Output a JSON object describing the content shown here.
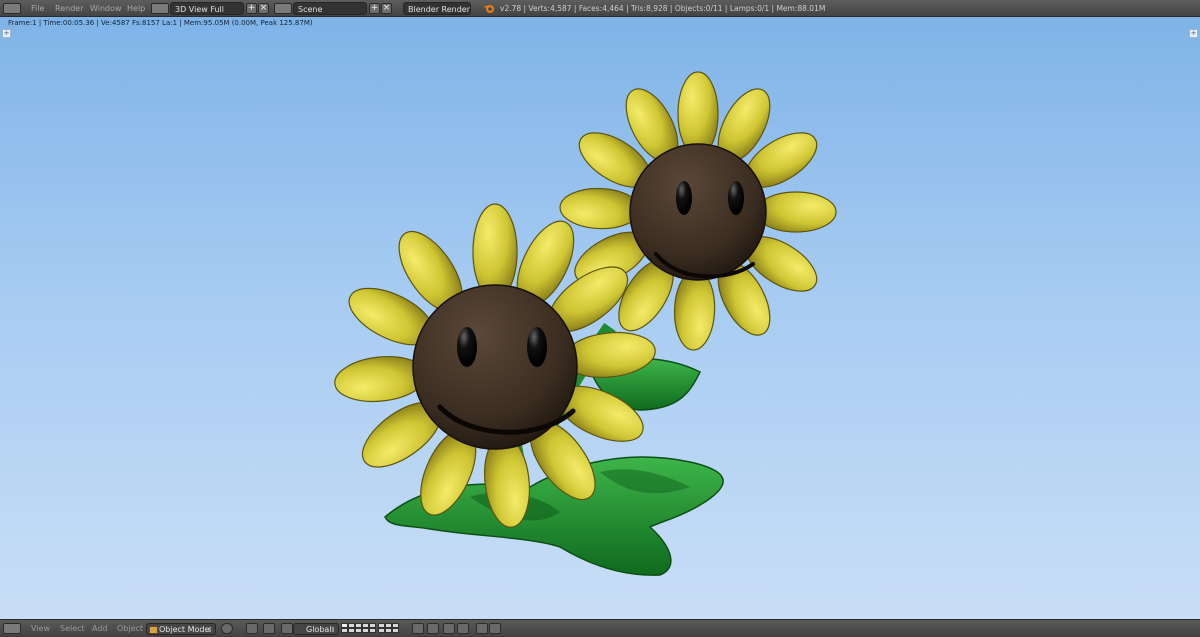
{
  "topbar": {
    "menus": [
      "File",
      "Render",
      "Window",
      "Help"
    ],
    "screen_layout": "3D View Full",
    "scene": "Scene",
    "render_engine": "Blender Render",
    "stats": "v2.78 | Verts:4,587 | Faces:4,464 | Tris:8,928 | Objects:0/11 | Lamps:0/1 | Mem:88.01M",
    "add_glyph": "+",
    "close_glyph": "×"
  },
  "viewport": {
    "frame_info": "Frame:1 | Time:00:05.36 | Ve:4587 Fs:8157 La:1 | Mem:95.05M (0.00M, Peak 125.87M)",
    "colors": {
      "sky_top": "#7fb3e7",
      "petal": "#c8c22e",
      "face": "#3a2c20",
      "leaf": "#1e8a2c"
    }
  },
  "bottombar": {
    "menus": [
      "View",
      "Select",
      "Add",
      "Object"
    ],
    "mode": "Object Mode",
    "orientation": "Global"
  }
}
